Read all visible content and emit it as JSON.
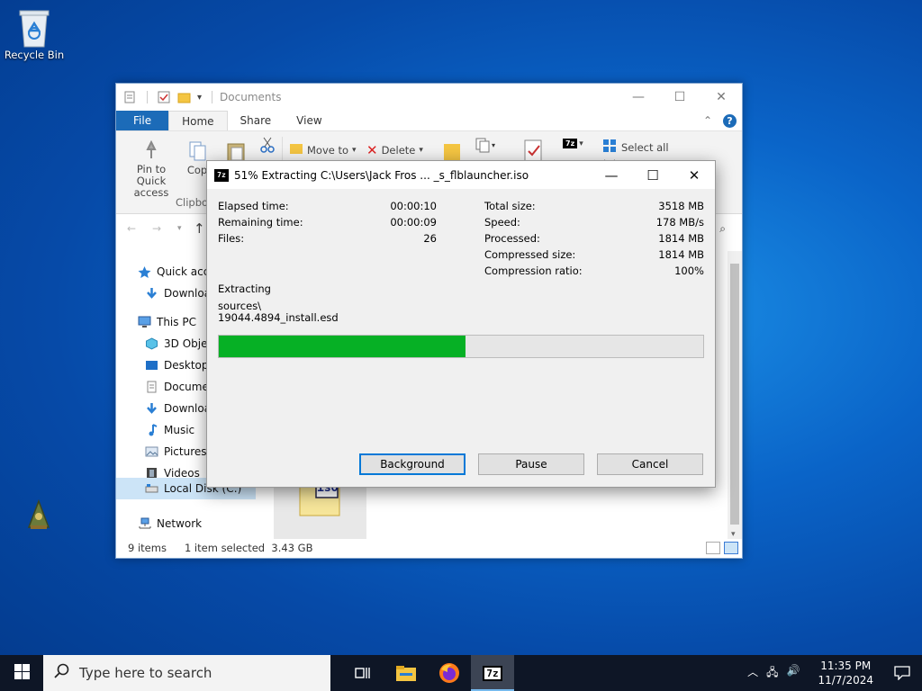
{
  "desktop": {
    "icons": [
      {
        "label": "Recycle Bin",
        "icon": "recycle-bin-icon"
      },
      {
        "label": "",
        "icon": "app-shortcut-icon"
      }
    ]
  },
  "explorer": {
    "title": "Documents",
    "tabs": {
      "file": "File",
      "home": "Home",
      "share": "Share",
      "view": "View"
    },
    "ribbon": {
      "pin_quick_access": "Pin to Quick access",
      "copy": "Cop",
      "clipboard_group": "Clipbo",
      "move_to": "Move to",
      "delete": "Delete",
      "select_all": "Select all"
    },
    "nav": [
      {
        "label": "Quick acce",
        "icon": "star-icon"
      },
      {
        "label": "Downloa",
        "icon": "download-arrow-icon"
      },
      {
        "label": "This PC",
        "icon": "computer-icon"
      },
      {
        "label": "3D Objec",
        "icon": "cube-icon"
      },
      {
        "label": "Desktop",
        "icon": "desktop-icon"
      },
      {
        "label": "Documer",
        "icon": "document-icon"
      },
      {
        "label": "Downloa",
        "icon": "download-arrow-icon"
      },
      {
        "label": "Music",
        "icon": "music-note-icon"
      },
      {
        "label": "Pictures",
        "icon": "pictures-icon"
      },
      {
        "label": "Videos",
        "icon": "film-icon"
      },
      {
        "label": "Local Disk (C:)",
        "icon": "drive-icon",
        "selected": true
      },
      {
        "label": "Network",
        "icon": "network-icon"
      }
    ],
    "file_item_label": "iso",
    "status": {
      "items": "9 items",
      "selected": "1 item selected  3.43 GB"
    }
  },
  "dialog": {
    "app_icon_text": "7z",
    "title": "51% Extracting C:\\Users\\Jack Fros ... _s_flblauncher.iso",
    "left_stats": [
      {
        "label": "Elapsed time:",
        "value": "00:00:10"
      },
      {
        "label": "Remaining time:",
        "value": "00:00:09"
      },
      {
        "label": "Files:",
        "value": "26"
      }
    ],
    "right_stats": [
      {
        "label": "Total size:",
        "value": "3518 MB"
      },
      {
        "label": "Speed:",
        "value": "178 MB/s"
      },
      {
        "label": "Processed:",
        "value": "1814 MB"
      },
      {
        "label": "Compressed size:",
        "value": "1814 MB"
      },
      {
        "label": "Compression ratio:",
        "value": "100%"
      }
    ],
    "operation_label": "Extracting",
    "current_path": "sources\\",
    "current_file": "19044.4894_install.esd",
    "progress": 0.51,
    "buttons": {
      "background": "Background",
      "pause": "Pause",
      "cancel": "Cancel"
    }
  },
  "taskbar": {
    "search_placeholder": "Type here to search",
    "time": "11:35 PM",
    "date": "11/7/2024",
    "apps": [
      "task-view-icon",
      "file-explorer-icon",
      "firefox-icon",
      "7zip-icon"
    ]
  },
  "colors": {
    "progress_fill": "#06b025",
    "file_tab": "#1c6bb8",
    "taskbar": "#0e1626"
  }
}
